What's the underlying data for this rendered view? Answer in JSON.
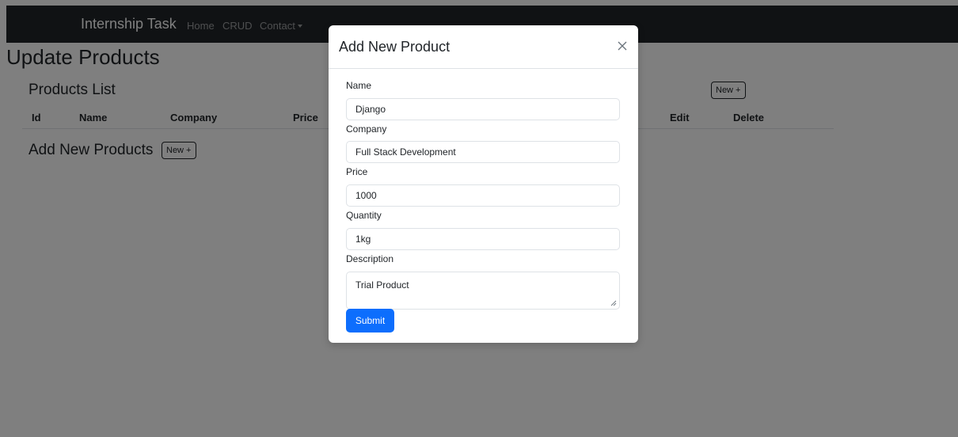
{
  "navbar": {
    "brand": "Internship Task",
    "links": [
      "Home",
      "CRUD",
      "Contact"
    ]
  },
  "page": {
    "title": "Update Products",
    "products_list_title": "Products List",
    "new_button": "New +",
    "table_headers": [
      "Id",
      "Name",
      "Company",
      "Price",
      "Edit",
      "Delete"
    ],
    "add_title": "Add New Products",
    "add_button": "New +"
  },
  "modal": {
    "title": "Add New Product",
    "fields": {
      "name": {
        "label": "Name",
        "value": "Django"
      },
      "company": {
        "label": "Company",
        "value": "Full Stack Development"
      },
      "price": {
        "label": "Price",
        "value": "1000"
      },
      "quantity": {
        "label": "Quantity",
        "value": "1kg"
      },
      "description": {
        "label": "Description",
        "value": "Trial Product"
      }
    },
    "submit_label": "Submit"
  },
  "colors": {
    "navbar": "#212529",
    "primary": "#0d6efd",
    "backdrop": "rgba(0,0,0,0.5)"
  }
}
